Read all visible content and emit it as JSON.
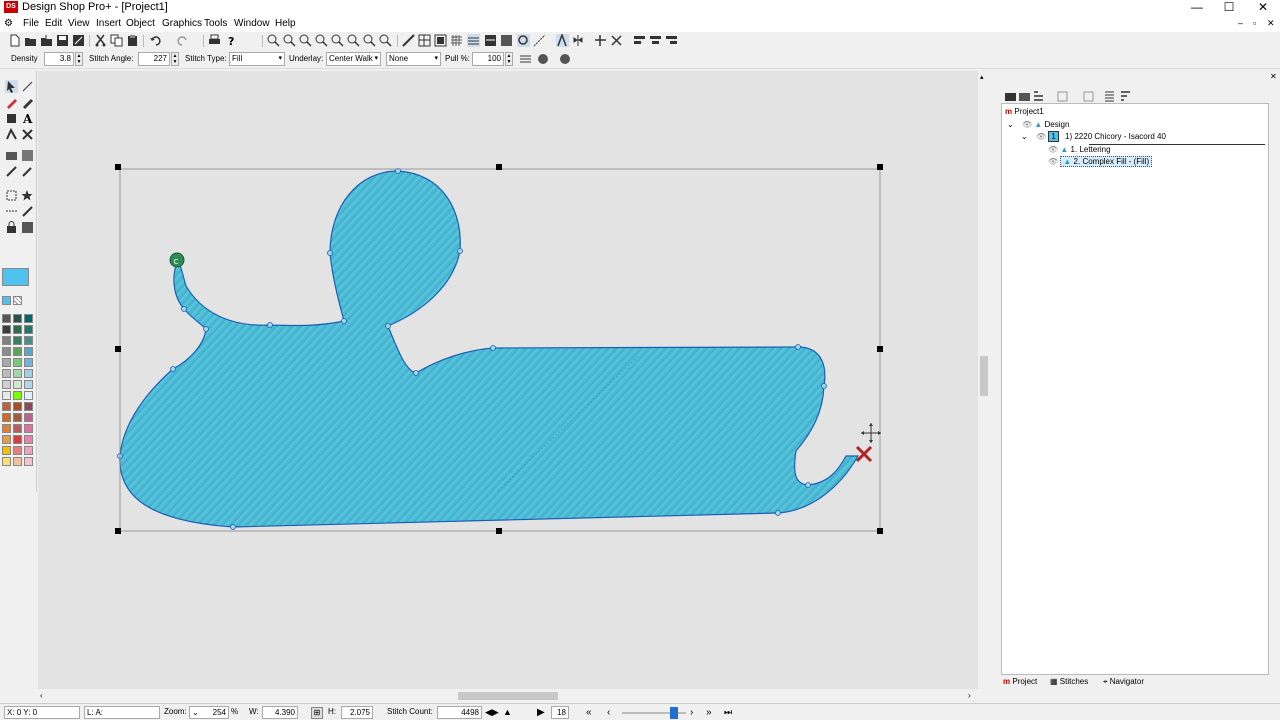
{
  "window": {
    "title": "Design Shop Pro+ - [Project1]",
    "icon_text": "DS"
  },
  "menu": [
    "File",
    "Edit",
    "View",
    "Insert",
    "Object",
    "Graphics",
    "Tools",
    "Window",
    "Help"
  ],
  "properties": {
    "density_label": "Density",
    "density_value": "3.8",
    "stitch_angle_label": "Stitch Angle:",
    "stitch_angle_value": "227",
    "stitch_type_label": "Stitch Type:",
    "stitch_type_value": "Fill",
    "underlay_label": "Underlay:",
    "underlay_value": "Center Walk",
    "underlay2_value": "None",
    "pull_label": "Pull %:",
    "pull_value": "100"
  },
  "tree": {
    "root": "Project1",
    "design": "Design",
    "thread": "1",
    "thread_text": "1) 2220 Chicory  - Isacord 40",
    "item1": "1. Lettering",
    "item2": "2. Complex Fill - (Fill)"
  },
  "panel_tabs": [
    "Project",
    "Stitches",
    "Navigator"
  ],
  "status": {
    "coords": "X: 0  Y: 0",
    "la": "L: A:",
    "zoom_label": "Zoom:",
    "zoom_value": "254",
    "zoom_unit": "%",
    "w_label": "W:",
    "w_value": "4.390",
    "h_label": "H:",
    "h_value": "2.075",
    "stitch_count_label": "Stitch Count:",
    "stitch_count_value": "4498",
    "step_value": "18"
  },
  "colors": {
    "fill": "#4cbcd6",
    "fill_dark": "#2c8fb4",
    "outline": "#1a5fb4",
    "current_color": "#4fc3ee",
    "marker_start": "#2e8b57",
    "marker_end": "#b22222"
  },
  "palette": [
    "#555555",
    "#2f4f4f",
    "#006666",
    "#3c3c3c",
    "#2e6b4e",
    "#1f7a6a",
    "#808080",
    "#3b7d5f",
    "#4a8f8a",
    "#8c8c8c",
    "#5ea35e",
    "#57a8c8",
    "#a9a9a9",
    "#7ec87e",
    "#6fb7d6",
    "#bcbcbc",
    "#a5d6a7",
    "#9cd1e6",
    "#d0d0d0",
    "#cfe8cf",
    "#add8e6",
    "#e8e8e8",
    "#7cfc00",
    "#e0f2ff",
    "#c0603a",
    "#a0522d",
    "#8b4a5a",
    "#d2691e",
    "#9b5f3f",
    "#c06090",
    "#e08030",
    "#b06060",
    "#e070a0",
    "#e0a040",
    "#d04040",
    "#f080b0",
    "#f0c000",
    "#e08080",
    "#f0a0c0",
    "#f8e070",
    "#f0c0a0",
    "#f8c0d0"
  ]
}
